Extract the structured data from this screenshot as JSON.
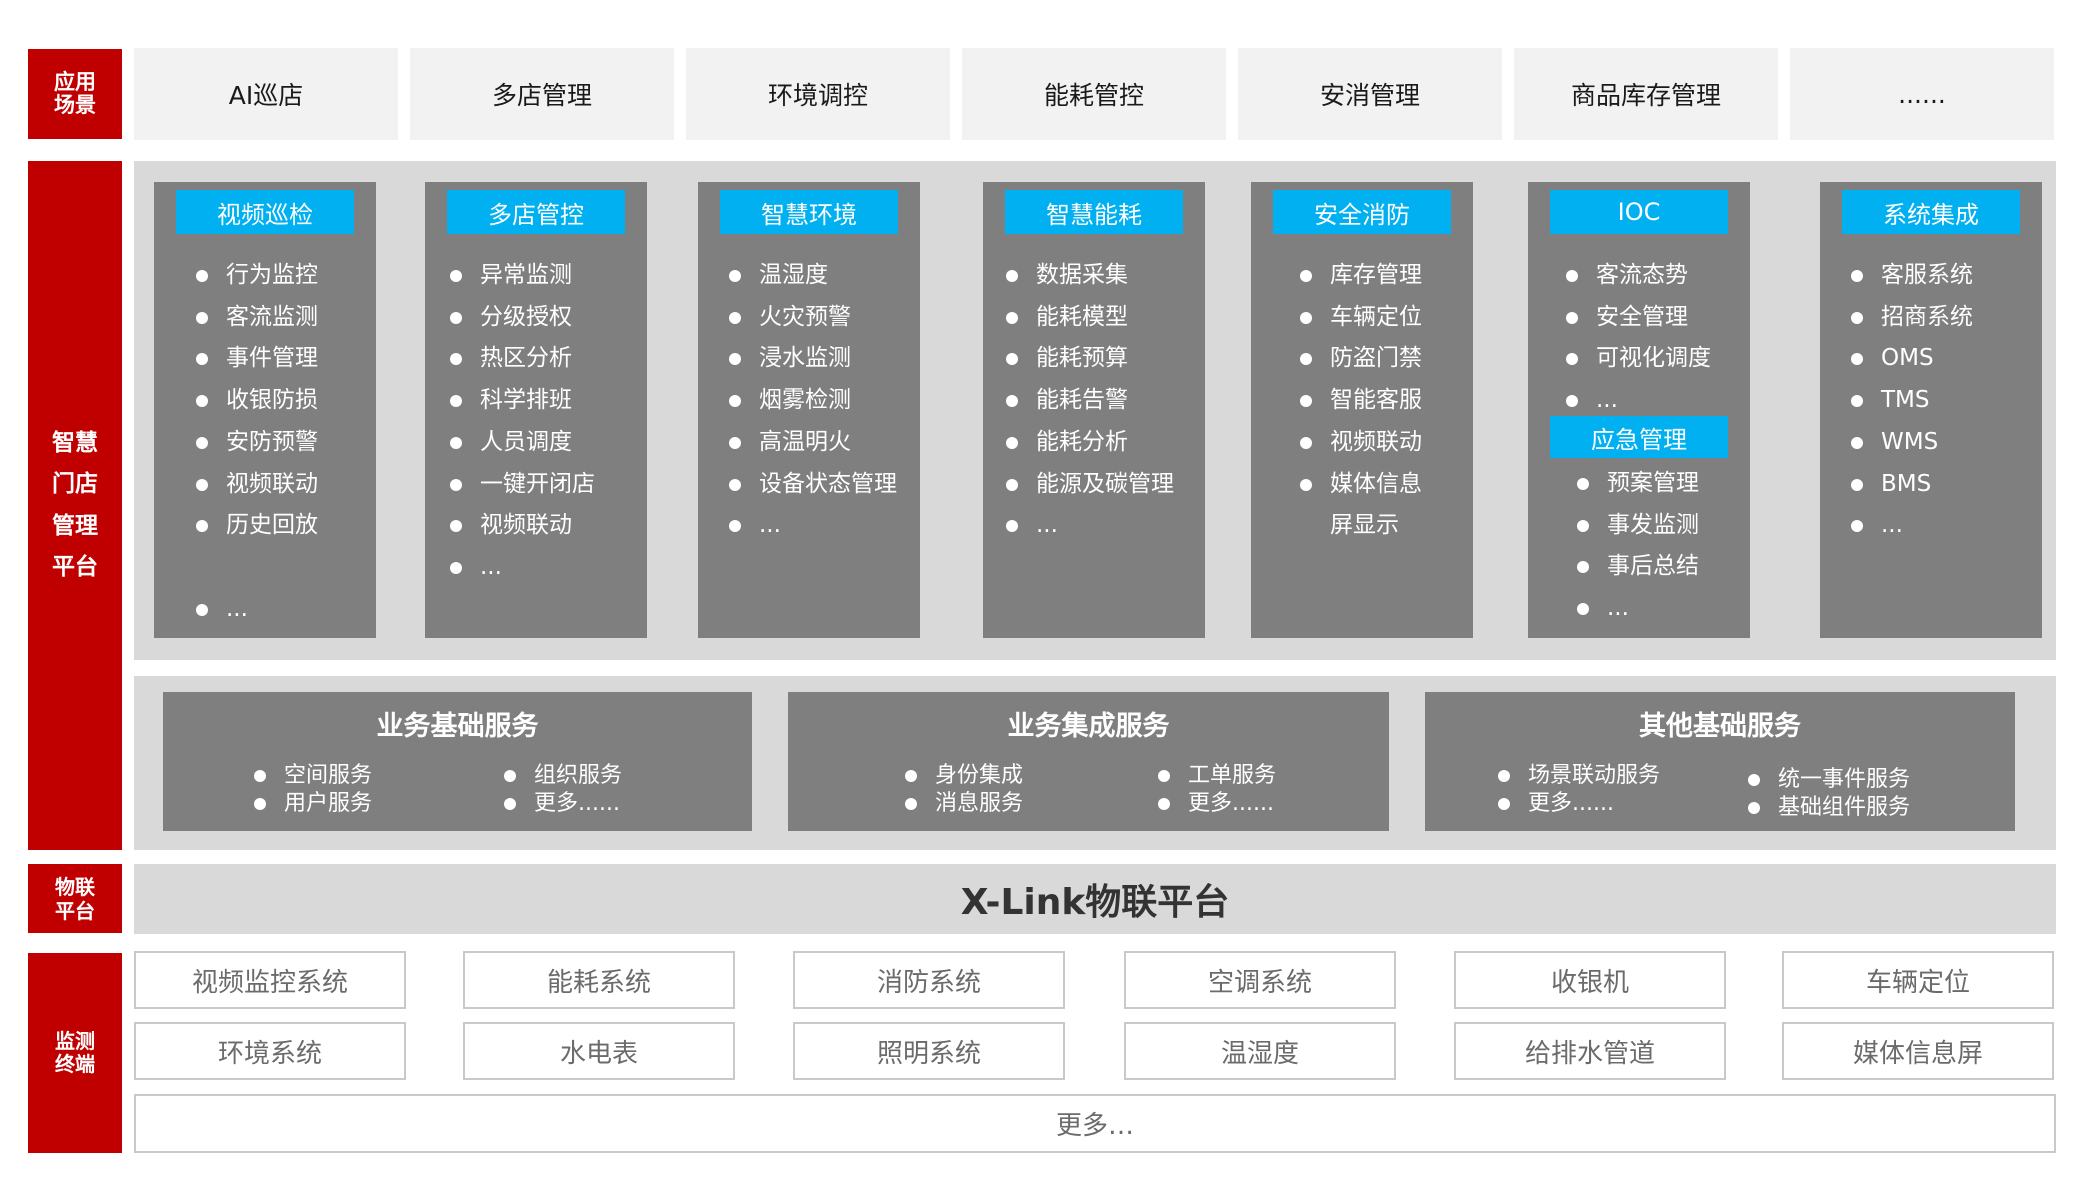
{
  "layers": {
    "application": {
      "label_lines": [
        "应用",
        "场景"
      ],
      "scenarios": [
        "AI巡店",
        "多店管理",
        "环境调控",
        "能耗管控",
        "安消管理",
        "商品库存管理",
        "......"
      ]
    },
    "platform": {
      "label_lines": [
        "智慧",
        "门店",
        "管理",
        "平台"
      ],
      "modules": [
        {
          "title": "视频巡检",
          "items": [
            "行为监控",
            "客流监测",
            "事件管理",
            "收银防损",
            "安防预警",
            "视频联动",
            "历史回放",
            "..."
          ]
        },
        {
          "title": "多店管控",
          "items": [
            "异常监测",
            "分级授权",
            "热区分析",
            "科学排班",
            "人员调度",
            "一键开闭店",
            "视频联动",
            "..."
          ]
        },
        {
          "title": "智慧环境",
          "items": [
            "温湿度",
            "火灾预警",
            "浸水监测",
            "烟雾检测",
            "高温明火",
            "设备状态管理",
            "..."
          ]
        },
        {
          "title": "智慧能耗",
          "items": [
            "数据采集",
            "能耗模型",
            "能耗预算",
            "能耗告警",
            "能耗分析",
            "能源及碳管理",
            "..."
          ]
        },
        {
          "title": "安全消防",
          "items": [
            "库存管理",
            "车辆定位",
            "防盗门禁",
            "智能客服",
            "视频联动",
            "媒体信息屏显示"
          ]
        },
        {
          "title": "IOC",
          "items": [
            "客流态势",
            "安全管理",
            "可视化调度",
            "..."
          ],
          "sub_title": "应急管理",
          "sub_items": [
            "预案管理",
            "事发监测",
            "事后总结",
            "..."
          ]
        },
        {
          "title": "系统集成",
          "items": [
            "客服系统",
            "招商系统",
            "OMS",
            "TMS",
            "WMS",
            "BMS",
            "..."
          ]
        }
      ],
      "services": [
        {
          "title": "业务基础服务",
          "col1": [
            "空间服务",
            "用户服务"
          ],
          "col2": [
            "组织服务",
            "更多......"
          ]
        },
        {
          "title": "业务集成服务",
          "col1": [
            "身份集成",
            "消息服务"
          ],
          "col2": [
            "工单服务",
            "更多......"
          ]
        },
        {
          "title": "其他基础服务",
          "col1": [
            "场景联动服务",
            "更多......"
          ],
          "col2": [
            "统一事件服务",
            "基础组件服务"
          ]
        }
      ]
    },
    "iot": {
      "label_lines": [
        "物联",
        "平台"
      ],
      "title": "X-Link物联平台"
    },
    "terminals": {
      "label_lines": [
        "监测",
        "终端"
      ],
      "row1": [
        "视频监控系统",
        "能耗系统",
        "消防系统",
        "空调系统",
        "收银机",
        "车辆定位"
      ],
      "row2": [
        "环境系统",
        "水电表",
        "照明系统",
        "温湿度",
        "给排水管道",
        "媒体信息屏"
      ],
      "more": "更多…"
    }
  },
  "colors": {
    "label_red": "#c00000",
    "module_header_blue": "#00b0f0",
    "module_gray": "#7f7f7f",
    "panel_gray": "#d9d9d9"
  }
}
